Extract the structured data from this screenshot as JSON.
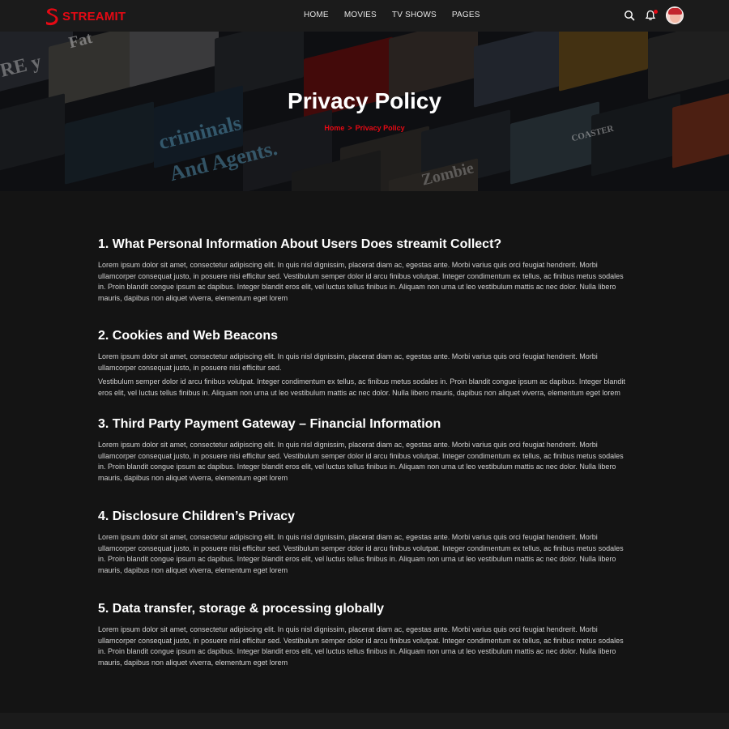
{
  "brand": {
    "name": "STREAMIT",
    "accent": "#e50914"
  },
  "nav": {
    "items": [
      "Home",
      "Movies",
      "TV Shows",
      "Pages"
    ]
  },
  "header_icons": [
    "search-icon",
    "bell-icon",
    "avatar"
  ],
  "banner": {
    "title": "Privacy Policy",
    "breadcrumb": {
      "home": "Home",
      "separator": ">",
      "current": "Privacy Policy"
    },
    "poster_words": [
      "Fat",
      "criminals",
      "And Agents.",
      "Zombie",
      "COASTER",
      "RE y"
    ]
  },
  "sections": [
    {
      "heading": "1. What Personal Information About Users Does streamit Collect?",
      "paragraphs": [
        "Lorem ipsum dolor sit amet, consectetur adipiscing elit. In quis nisl dignissim, placerat diam ac, egestas ante. Morbi varius quis orci feugiat hendrerit. Morbi ullamcorper consequat justo, in posuere nisi efficitur sed. Vestibulum semper dolor id arcu finibus volutpat. Integer condimentum ex tellus, ac finibus metus sodales in. Proin blandit congue ipsum ac dapibus. Integer blandit eros elit, vel luctus tellus finibus in. Aliquam non urna ut leo vestibulum mattis ac nec dolor. Nulla libero mauris, dapibus non aliquet viverra, elementum eget lorem"
      ]
    },
    {
      "heading": "2. Cookies and Web Beacons",
      "paragraphs": [
        "Lorem ipsum dolor sit amet, consectetur adipiscing elit. In quis nisl dignissim, placerat diam ac, egestas ante. Morbi varius quis orci feugiat hendrerit. Morbi ullamcorper consequat justo, in posuere nisi efficitur sed.",
        "Vestibulum semper dolor id arcu finibus volutpat. Integer condimentum ex tellus, ac finibus metus sodales in. Proin blandit congue ipsum ac dapibus. Integer blandit eros elit, vel luctus tellus finibus in. Aliquam non urna ut leo vestibulum mattis ac nec dolor. Nulla libero mauris, dapibus non aliquet viverra, elementum eget lorem"
      ]
    },
    {
      "heading": "3. Third Party Payment Gateway – Financial Information",
      "paragraphs": [
        "Lorem ipsum dolor sit amet, consectetur adipiscing elit. In quis nisl dignissim, placerat diam ac, egestas ante. Morbi varius quis orci feugiat hendrerit. Morbi ullamcorper consequat justo, in posuere nisi efficitur sed. Vestibulum semper dolor id arcu finibus volutpat. Integer condimentum ex tellus, ac finibus metus sodales in. Proin blandit congue ipsum ac dapibus. Integer blandit eros elit, vel luctus tellus finibus in. Aliquam non urna ut leo vestibulum mattis ac nec dolor. Nulla libero mauris, dapibus non aliquet viverra, elementum eget lorem"
      ]
    },
    {
      "heading": "4. Disclosure Children’s Privacy",
      "paragraphs": [
        "Lorem ipsum dolor sit amet, consectetur adipiscing elit. In quis nisl dignissim, placerat diam ac, egestas ante. Morbi varius quis orci feugiat hendrerit. Morbi ullamcorper consequat justo, in posuere nisi efficitur sed. Vestibulum semper dolor id arcu finibus volutpat. Integer condimentum ex tellus, ac finibus metus sodales in. Proin blandit congue ipsum ac dapibus. Integer blandit eros elit, vel luctus tellus finibus in. Aliquam non urna ut leo vestibulum mattis ac nec dolor. Nulla libero mauris, dapibus non aliquet viverra, elementum eget lorem"
      ]
    },
    {
      "heading": "5. Data transfer, storage & processing globally",
      "paragraphs": [
        "Lorem ipsum dolor sit amet, consectetur adipiscing elit. In quis nisl dignissim, placerat diam ac, egestas ante. Morbi varius quis orci feugiat hendrerit. Morbi ullamcorper consequat justo, in posuere nisi efficitur sed. Vestibulum semper dolor id arcu finibus volutpat. Integer condimentum ex tellus, ac finibus metus sodales in. Proin blandit congue ipsum ac dapibus. Integer blandit eros elit, vel luctus tellus finibus in. Aliquam non urna ut leo vestibulum mattis ac nec dolor. Nulla libero mauris, dapibus non aliquet viverra, elementum eget lorem"
      ]
    }
  ]
}
